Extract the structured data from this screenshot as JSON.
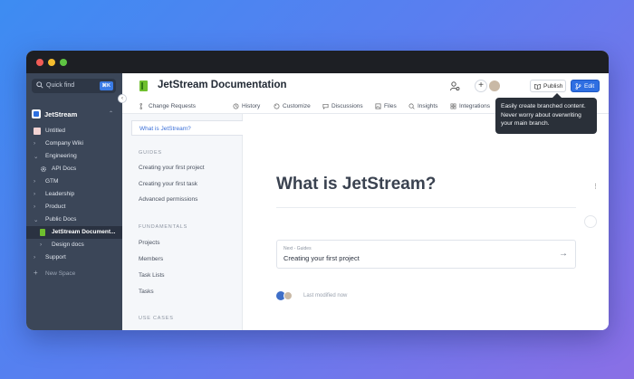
{
  "colors": {
    "accent": "#2f6fe2",
    "sidebar_bg": "#3b4658",
    "doc_icon": "#6fbf2e"
  },
  "window": {
    "controls": [
      "close",
      "minimize",
      "maximize"
    ]
  },
  "sidebar": {
    "quick_find": {
      "label": "Quick find",
      "shortcut": "⌘K",
      "icon": "search-icon"
    },
    "space": {
      "name": "JetStream"
    },
    "items": [
      {
        "label": "Untitled"
      },
      {
        "label": "Company Wiki"
      },
      {
        "label": "Engineering"
      },
      {
        "label": "API Docs"
      },
      {
        "label": "GTM"
      },
      {
        "label": "Leadership"
      },
      {
        "label": "Product"
      },
      {
        "label": "Public Docs"
      },
      {
        "label": "JetStream Document..."
      },
      {
        "label": "Design docs"
      },
      {
        "label": "Support"
      },
      {
        "label": "New Space"
      }
    ]
  },
  "header": {
    "title": "JetStream Documentation",
    "publish_label": "Publish",
    "edit_label": "Edit"
  },
  "tabs": [
    {
      "label": "Change Requests"
    },
    {
      "label": "History"
    },
    {
      "label": "Customize"
    },
    {
      "label": "Discussions"
    },
    {
      "label": "Files"
    },
    {
      "label": "Insights"
    },
    {
      "label": "Integrations"
    }
  ],
  "toc": {
    "active": "What is JetStream?",
    "guides_label": "GUIDES",
    "guides": [
      "Creating your first project",
      "Creating your first task",
      "Advanced permissions"
    ],
    "fundamentals_label": "FUNDAMENTALS",
    "fundamentals": [
      "Projects",
      "Members",
      "Task Lists",
      "Tasks"
    ],
    "use_cases_label": "USE CASES"
  },
  "content": {
    "title": "What is JetStream?",
    "next_small": "Next - Guides",
    "next_title": "Creating your first project",
    "modified": "Last modified now"
  },
  "tooltip": {
    "text": "Easily create branched content. Never worry about overwriting your main branch."
  }
}
